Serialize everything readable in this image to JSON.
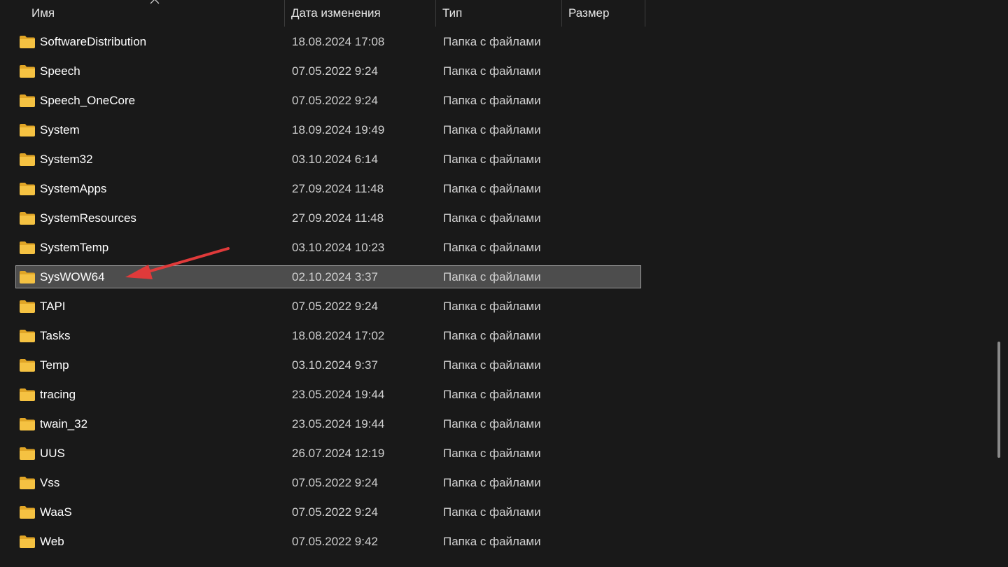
{
  "columns": {
    "name": "Имя",
    "date": "Дата изменения",
    "type": "Тип",
    "size": "Размер"
  },
  "icons": {
    "folder": "folder-icon",
    "sort": "sort-up-chevron-icon",
    "annotation": "red-arrow-icon"
  },
  "colors": {
    "folder": "#f5c242",
    "selection_bg": "#4d4d4d",
    "annotation_arrow": "#e03a3a"
  },
  "rows": [
    {
      "name": "SoftwareDistribution",
      "date": "18.08.2024 17:08",
      "type": "Папка с файлами"
    },
    {
      "name": "Speech",
      "date": "07.05.2022 9:24",
      "type": "Папка с файлами"
    },
    {
      "name": "Speech_OneCore",
      "date": "07.05.2022 9:24",
      "type": "Папка с файлами"
    },
    {
      "name": "System",
      "date": "18.09.2024 19:49",
      "type": "Папка с файлами"
    },
    {
      "name": "System32",
      "date": "03.10.2024 6:14",
      "type": "Папка с файлами"
    },
    {
      "name": "SystemApps",
      "date": "27.09.2024 11:48",
      "type": "Папка с файлами"
    },
    {
      "name": "SystemResources",
      "date": "27.09.2024 11:48",
      "type": "Папка с файлами"
    },
    {
      "name": "SystemTemp",
      "date": "03.10.2024 10:23",
      "type": "Папка с файлами"
    },
    {
      "name": "SysWOW64",
      "date": "02.10.2024 3:37",
      "type": "Папка с файлами",
      "selected": true
    },
    {
      "name": "TAPI",
      "date": "07.05.2022 9:24",
      "type": "Папка с файлами"
    },
    {
      "name": "Tasks",
      "date": "18.08.2024 17:02",
      "type": "Папка с файлами"
    },
    {
      "name": "Temp",
      "date": "03.10.2024 9:37",
      "type": "Папка с файлами"
    },
    {
      "name": "tracing",
      "date": "23.05.2024 19:44",
      "type": "Папка с файлами"
    },
    {
      "name": "twain_32",
      "date": "23.05.2024 19:44",
      "type": "Папка с файлами"
    },
    {
      "name": "UUS",
      "date": "26.07.2024 12:19",
      "type": "Папка с файлами"
    },
    {
      "name": "Vss",
      "date": "07.05.2022 9:24",
      "type": "Папка с файлами"
    },
    {
      "name": "WaaS",
      "date": "07.05.2022 9:24",
      "type": "Папка с файлами"
    },
    {
      "name": "Web",
      "date": "07.05.2022 9:42",
      "type": "Папка с файлами"
    }
  ]
}
